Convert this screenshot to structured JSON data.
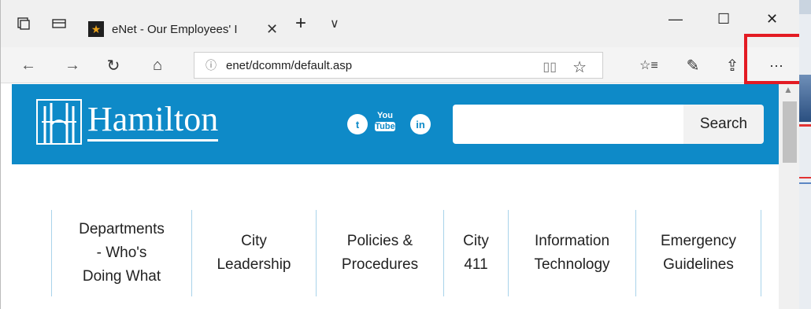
{
  "browser": {
    "tab_title": "eNet - Our Employees' I",
    "url": "enet/dcomm/default.asp",
    "window_controls": {
      "minimize": "—",
      "maximize": "☐",
      "close": "✕"
    },
    "nav": {
      "back": "←",
      "forward": "→",
      "refresh": "↻",
      "home": "⌂"
    },
    "toolbar": {
      "favorites": "☆≡",
      "notes": "✎",
      "share": "⇪",
      "more": "···"
    },
    "tab_close": "✕",
    "new_tab": "+",
    "tab_menu": "∨",
    "reading_view": "▯▯",
    "favorite": "☆",
    "info": "ⓘ"
  },
  "page": {
    "brand": "Hamilton",
    "social": {
      "twitter": "t",
      "youtube_top": "You",
      "youtube_bottom": "Tube",
      "linkedin": "in"
    },
    "search": {
      "button": "Search",
      "placeholder": ""
    },
    "menu": [
      {
        "label_line1": "Departments",
        "label_line2": "- Who's",
        "label_line3": "Doing What"
      },
      {
        "label_line1": "City",
        "label_line2": "Leadership"
      },
      {
        "label_line1": "Policies &",
        "label_line2": "Procedures"
      },
      {
        "label_line1": "City",
        "label_line2": "411"
      },
      {
        "label_line1": "Information",
        "label_line2": "Technology"
      },
      {
        "label_line1": "Emergency",
        "label_line2": "Guidelines"
      }
    ]
  },
  "colors": {
    "banner": "#0e8ac8",
    "highlight": "#e31b23",
    "menu_divider": "#a9d3ea"
  }
}
